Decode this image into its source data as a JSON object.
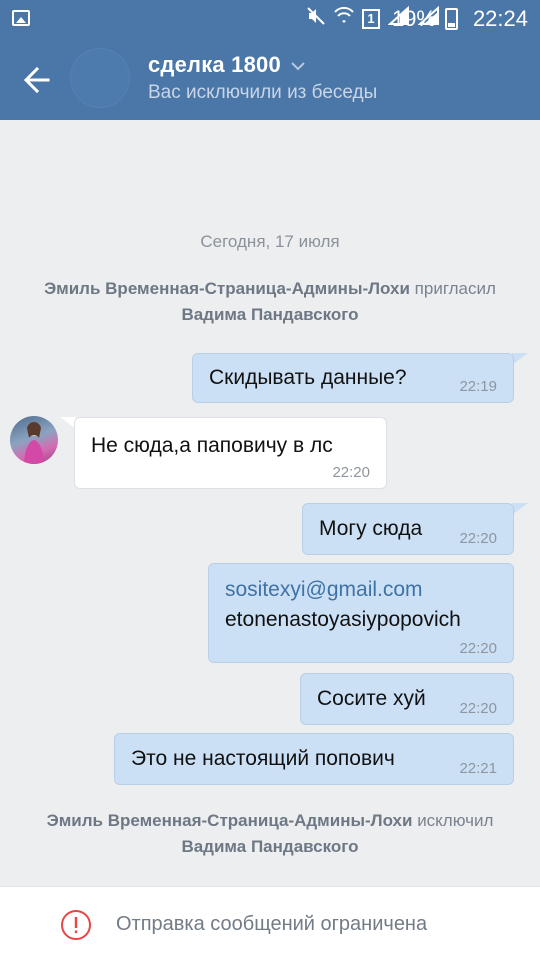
{
  "statusbar": {
    "sim": "1",
    "battery": "19%",
    "time": "22:24"
  },
  "header": {
    "title": "сделка 1800",
    "subtitle": "Вас исключили из беседы"
  },
  "chat": {
    "date": "Сегодня, 17 июля",
    "service_invite": {
      "actor": "Эмиль Временная-Страница-Админы-Лохи",
      "action": "пригласил",
      "target": "Вадима Пандавского"
    },
    "messages": [
      {
        "direction": "out",
        "text": "Скидывать данные?",
        "time": "22:19"
      },
      {
        "direction": "in",
        "text": "Не сюда,а паповичу в лс",
        "time": "22:20"
      },
      {
        "direction": "out",
        "text": "Могу сюда",
        "time": "22:20"
      },
      {
        "direction": "out",
        "link": "sositexyi@gmail.com",
        "text": "etonenastoyasiypopovich",
        "time": "22:20"
      },
      {
        "direction": "out",
        "text": "Сосите хуй",
        "time": "22:20"
      },
      {
        "direction": "out",
        "text": "Это не настоящий попович",
        "time": "22:21"
      }
    ],
    "service_kick": {
      "actor": "Эмиль Временная-Страница-Админы-Лохи",
      "action": "исключил",
      "target": "Вадима Пандавского"
    }
  },
  "footer": {
    "text": "Отправка сообщений ограничена"
  },
  "colors": {
    "header": "#4a76a8",
    "outgoing_bubble": "#cce0f5",
    "warning": "#e64646"
  }
}
